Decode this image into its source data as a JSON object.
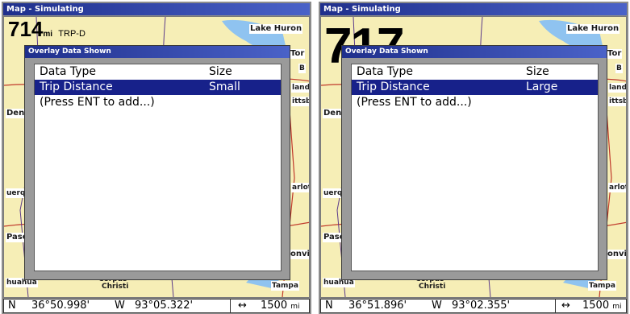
{
  "panels": [
    {
      "title": "Map - Simulating",
      "overlay_value": "714",
      "overlay_unit": "mi",
      "overlay_label": "TRP-D",
      "dialog_title": "Overlay Data Shown",
      "header": {
        "col1": "Data Type",
        "col2": "Size"
      },
      "rows": [
        {
          "col1": "Trip Distance",
          "col2": "Small",
          "selected": true
        },
        {
          "col1": "(Press ENT to add...)",
          "col2": ""
        }
      ],
      "map_labels": {
        "lake_huron": "Lake Huron",
        "tor": "Tor",
        "denver": "Den",
        "albuquerque": "uerqu",
        "el_paso": "Paso",
        "chihuahua": "huahua",
        "corpus": "Corpus",
        "christi": "Christi",
        "tampa": "Tampa",
        "cleveland": "land",
        "pittsburgh": "ittsbu",
        "charlotte": "arlott",
        "jacksonville": "onvill",
        "buffalo": "B"
      },
      "status": {
        "ns": "N",
        "lat": "36°50.998'",
        "ew": "W",
        "lon": "93°05.322'",
        "arrow": "↔",
        "zoom": "1500",
        "zoom_unit": "mi"
      }
    },
    {
      "title": "Map - Simulating",
      "overlay_value": "717",
      "dialog_title": "Overlay Data Shown",
      "header": {
        "col1": "Data Type",
        "col2": "Size"
      },
      "rows": [
        {
          "col1": "Trip Distance",
          "col2": "Large",
          "selected": true
        },
        {
          "col1": "(Press ENT to add...)",
          "col2": ""
        }
      ],
      "map_labels": {
        "lake_huron": "Lake Huron",
        "tor": "Tor",
        "denver": "Den",
        "albuquerque": "uerqu",
        "el_paso": "Paso",
        "chihuahua": "huahua",
        "corpus": "Corpus",
        "christi": "Christi",
        "tampa": "Tampa",
        "cleveland": "land",
        "pittsburgh": "ittsbu",
        "charlotte": "arlott",
        "jacksonville": "onvill",
        "buffalo": "B"
      },
      "status": {
        "ns": "N",
        "lat": "36°51.896'",
        "ew": "W",
        "lon": "93°02.355'",
        "arrow": "↔",
        "zoom": "1500",
        "zoom_unit": "mi"
      }
    }
  ],
  "colors": {
    "titlebar": "#1f2f8c",
    "selection": "#17218a",
    "map_land": "#f6eeb6",
    "water": "#8fc3f0",
    "road": "#c0392b"
  }
}
